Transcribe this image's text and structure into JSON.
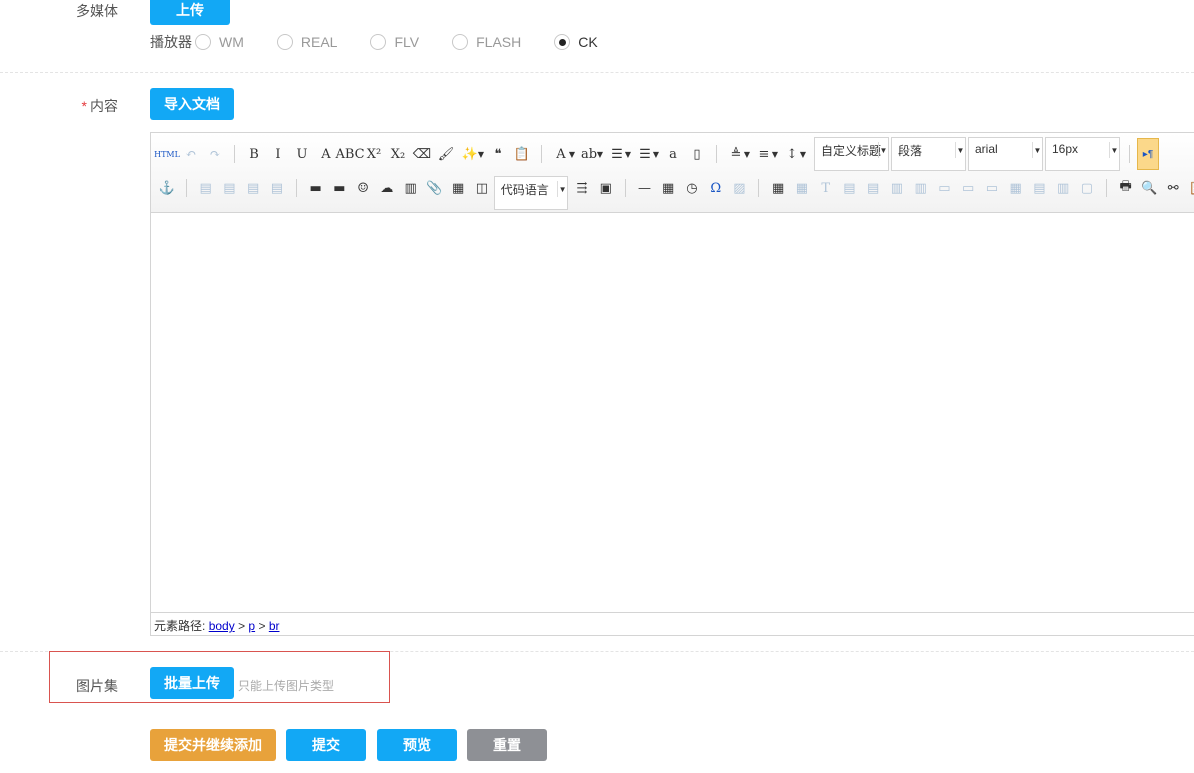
{
  "multimedia": {
    "label": "多媒体",
    "upload": "上传",
    "player_label": "播放器",
    "players": [
      {
        "label": "WM",
        "checked": false
      },
      {
        "label": "REAL",
        "checked": false
      },
      {
        "label": "FLV",
        "checked": false
      },
      {
        "label": "FLASH",
        "checked": false
      },
      {
        "label": "CK",
        "checked": true
      }
    ]
  },
  "content": {
    "required": "*",
    "label": "内容",
    "import": "导入文档"
  },
  "editor": {
    "row1": [
      [
        "html-icon",
        "HTML"
      ],
      [
        "undo-icon",
        "↶",
        1
      ],
      [
        "redo-icon",
        "↷",
        1
      ],
      [
        "|"
      ],
      [
        "bold-icon",
        "B"
      ],
      [
        "italic-icon",
        "I"
      ],
      [
        "underline-icon",
        "U"
      ],
      [
        "font-border-icon",
        "A"
      ],
      [
        "strikethrough-icon",
        "ABC"
      ],
      [
        "superscript-icon",
        "X²"
      ],
      [
        "subscript-icon",
        "X₂"
      ],
      [
        "eraser-icon",
        "⌫"
      ],
      [
        "format-brush-icon",
        "🖌"
      ],
      [
        "auto-typeset-icon",
        "✨"
      ],
      [
        "v"
      ],
      [
        "blockquote-icon",
        "❝"
      ],
      [
        "paste-text-icon",
        "📋"
      ],
      [
        "|"
      ],
      [
        "font-color-icon",
        "A"
      ],
      [
        "v"
      ],
      [
        "highlight-icon",
        "ab"
      ],
      [
        "v"
      ],
      [
        "ordered-list-icon",
        "☰"
      ],
      [
        "v"
      ],
      [
        "unordered-list-icon",
        "☰"
      ],
      [
        "v"
      ],
      [
        "select-all-icon",
        "a"
      ],
      [
        "clear-doc-icon",
        "▯"
      ],
      [
        "|"
      ],
      [
        "row-spacing-top-icon",
        "≜"
      ],
      [
        "v"
      ],
      [
        "row-spacing-bottom-icon",
        "≡"
      ],
      [
        "v"
      ],
      [
        "line-height-icon",
        "↕"
      ],
      [
        "v"
      ]
    ],
    "selects": [
      {
        "name": "custom-heading-select",
        "value": "自定义标题"
      },
      {
        "name": "paragraph-select",
        "value": "段落"
      },
      {
        "name": "font-family-select",
        "value": "arial"
      },
      {
        "name": "font-size-select",
        "value": "16px"
      }
    ],
    "row2": [
      [
        "anchor-icon",
        "⚓"
      ],
      [
        "|"
      ],
      [
        "align-left-icon",
        "▤",
        1
      ],
      [
        "align-right-icon",
        "▤",
        1
      ],
      [
        "align-center-icon",
        "▤",
        1
      ],
      [
        "align-justify-icon",
        "▤",
        1
      ],
      [
        "|"
      ],
      [
        "image-icon",
        "▬"
      ],
      [
        "multi-image-icon",
        "▬"
      ],
      [
        "emotion-icon",
        "☺"
      ],
      [
        "scrawl-icon",
        "☁"
      ],
      [
        "video-icon",
        "▥"
      ],
      [
        "attachment-icon",
        "📎"
      ],
      [
        "map-icon",
        "▦"
      ],
      [
        "iframe-icon",
        "◫"
      ]
    ],
    "code_select": "代码语言",
    "row2b": [
      [
        "pagebreak-icon",
        "⇶"
      ],
      [
        "template-icon",
        "▣"
      ],
      [
        "|"
      ],
      [
        "horizontal-rule-icon",
        "—"
      ],
      [
        "date-icon",
        "▦"
      ],
      [
        "time-icon",
        "◷"
      ],
      [
        "special-char-icon",
        "Ω"
      ],
      [
        "word-image-icon",
        "▨",
        1
      ],
      [
        "|"
      ],
      [
        "insert-table-icon",
        "▦"
      ],
      [
        "delete-table-icon",
        "▦",
        1
      ],
      [
        "table-caption-icon",
        "T",
        1
      ],
      [
        "insert-row-icon",
        "▤",
        1
      ],
      [
        "delete-row-icon",
        "▤",
        1
      ],
      [
        "insert-col-icon",
        "▥",
        1
      ],
      [
        "delete-col-icon",
        "▥",
        1
      ],
      [
        "merge-cells-icon",
        "▭",
        1
      ],
      [
        "merge-right-icon",
        "▭",
        1
      ],
      [
        "merge-down-icon",
        "▭",
        1
      ],
      [
        "split-cells-icon",
        "▦",
        1
      ],
      [
        "split-rows-icon",
        "▤",
        1
      ],
      [
        "split-cols-icon",
        "▥",
        1
      ],
      [
        "table-bg-icon",
        "▢",
        1
      ],
      [
        "|"
      ],
      [
        "print-icon",
        "🖶"
      ],
      [
        "preview-icon",
        "🔍"
      ],
      [
        "search-replace-icon",
        "⚯"
      ],
      [
        "paste-icon",
        "📋"
      ]
    ],
    "path_label": "元素路径:",
    "path": [
      "body",
      "p",
      "br"
    ],
    "sep": ">"
  },
  "gallery": {
    "label": "图片集",
    "upload": "批量上传",
    "hint": "只能上传图片类型"
  },
  "actions": {
    "submit_continue": "提交并继续添加",
    "submit": "提交",
    "preview": "预览",
    "reset": "重置"
  }
}
